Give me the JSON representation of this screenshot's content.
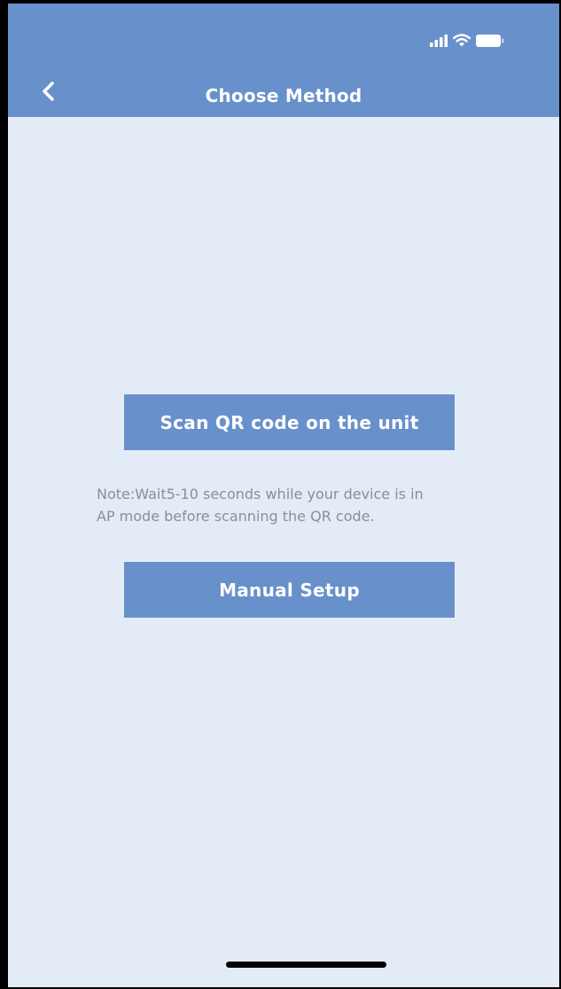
{
  "header": {
    "title": "Choose Method",
    "background_color": "#6890cb"
  },
  "status_bar": {
    "icons": [
      "signal-icon",
      "wifi-icon",
      "battery-icon"
    ]
  },
  "main": {
    "background_color": "#e3ecf6",
    "scan_button_label": "Scan QR code on the unit",
    "note_line1": "Note:Wait5-10 seconds while your device is in",
    "note_line2": "AP mode before scanning the QR code.",
    "manual_button_label": "Manual Setup"
  }
}
